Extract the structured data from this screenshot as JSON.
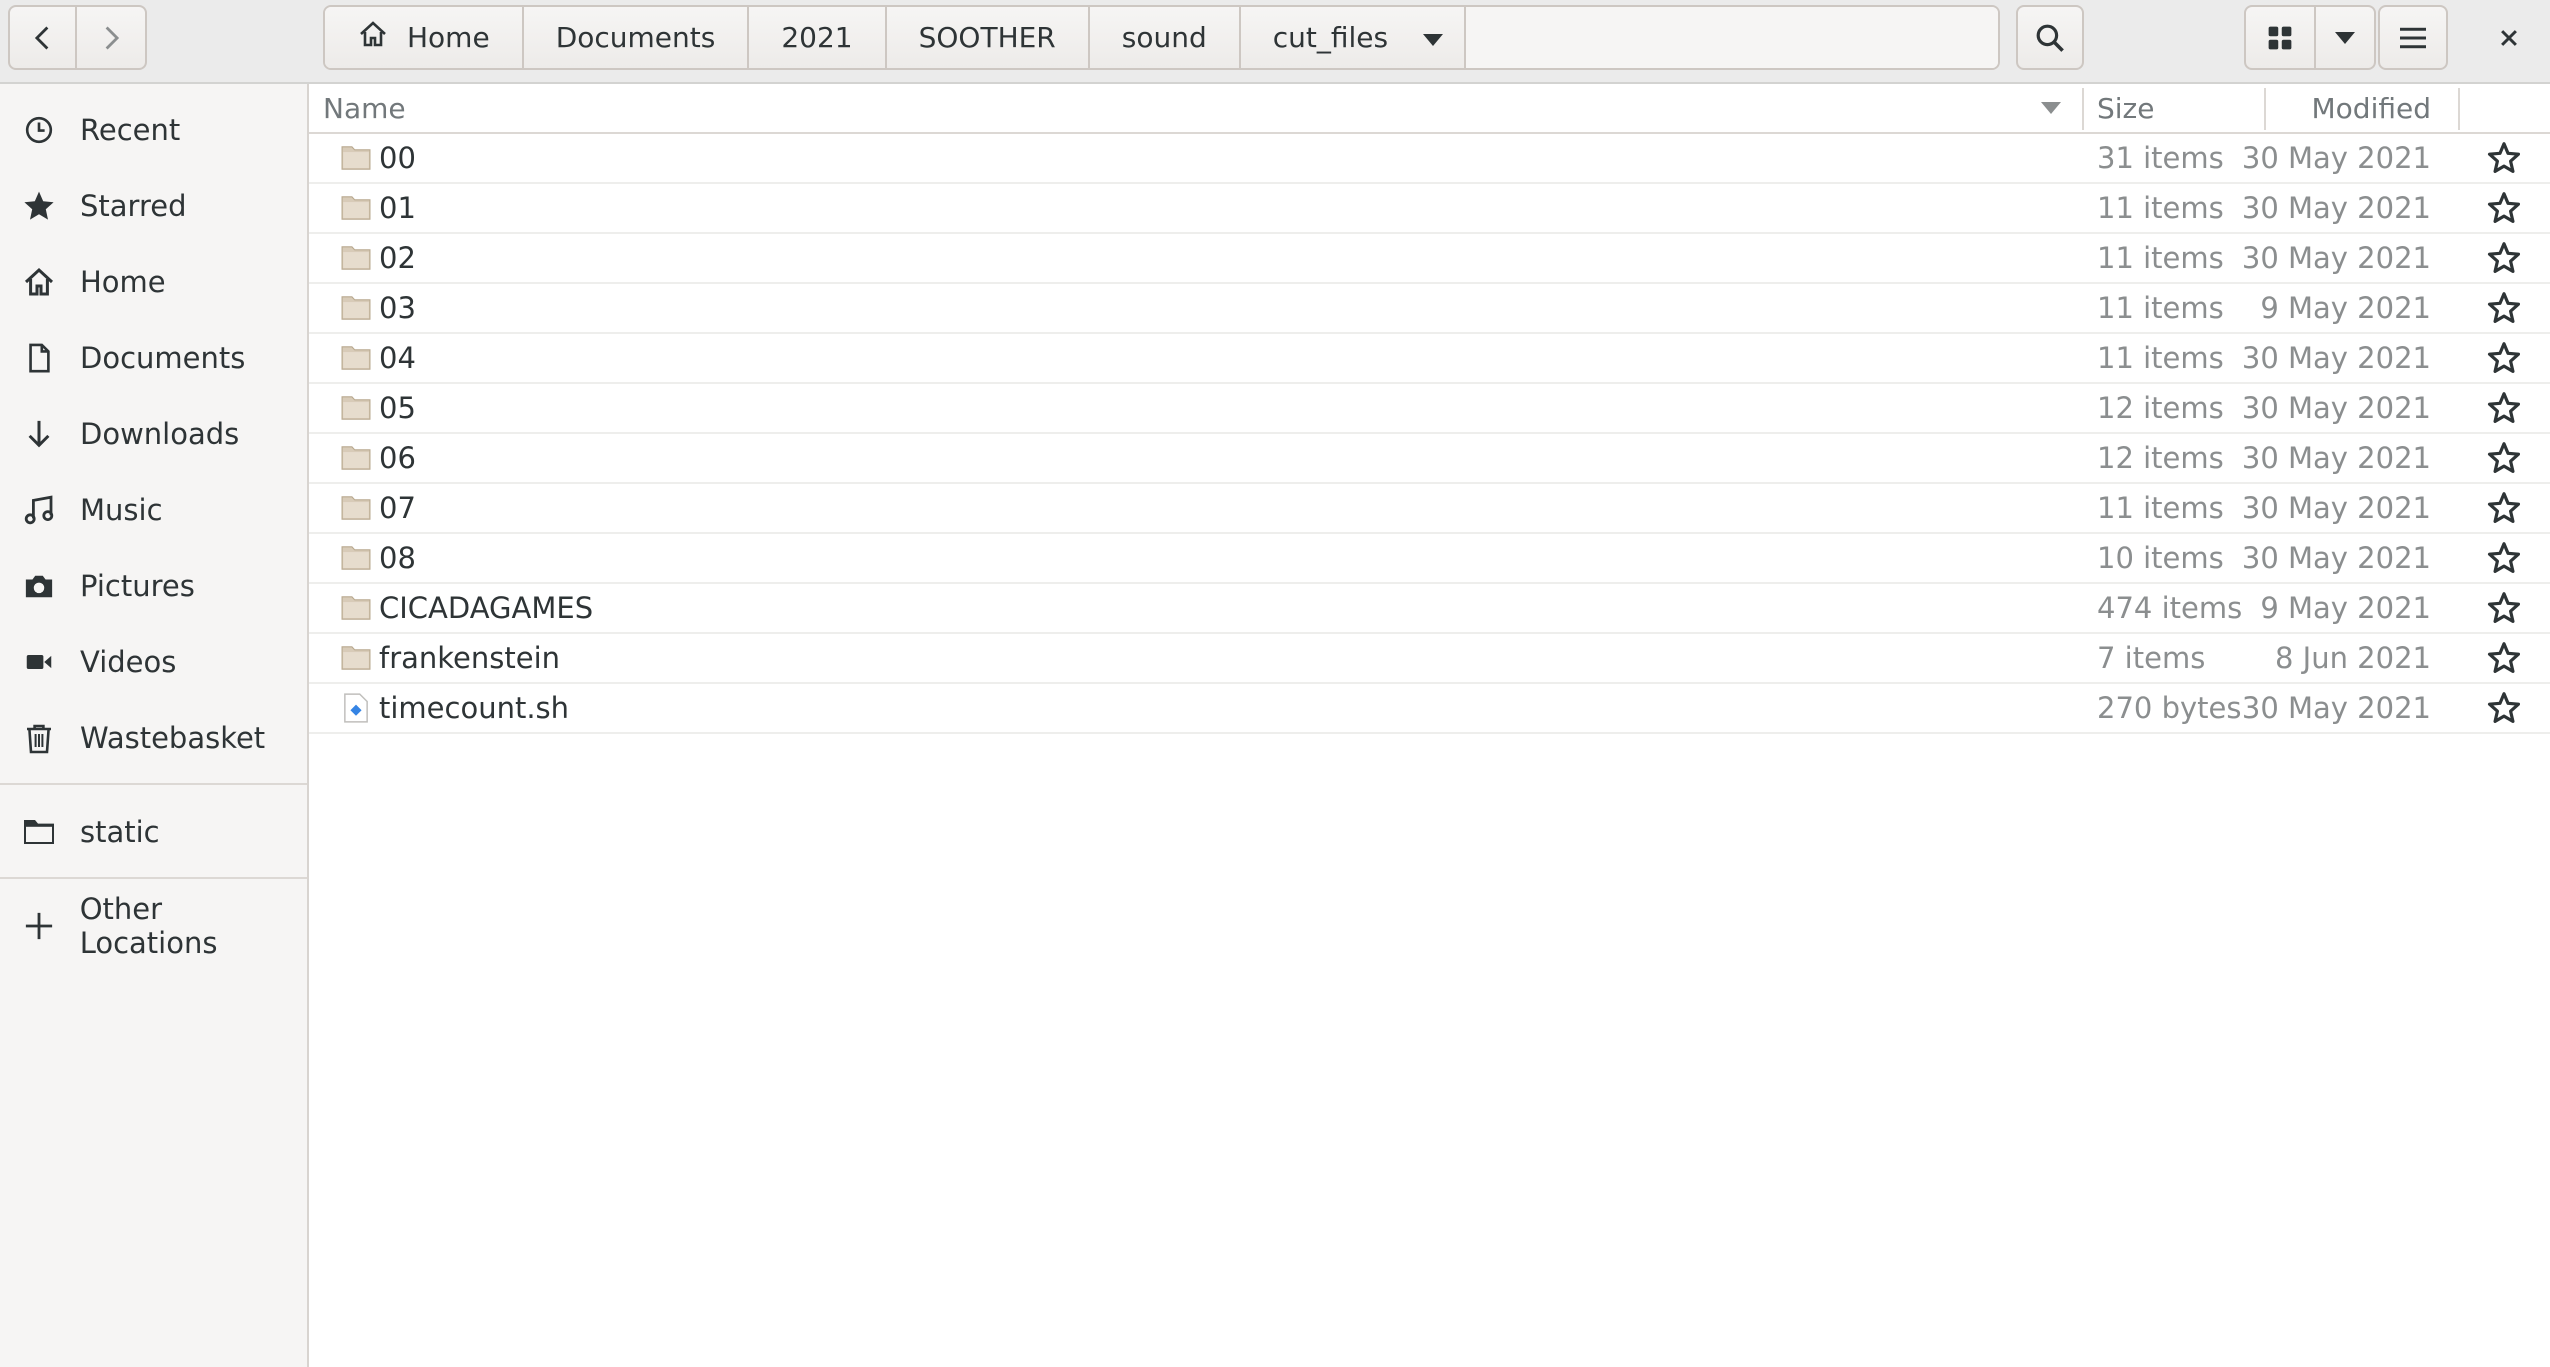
{
  "header": {
    "breadcrumbs": [
      "Home",
      "Documents",
      "2021",
      "SOOTHER",
      "sound",
      "cut_files"
    ],
    "icons": {
      "back": "go-previous-icon",
      "forward": "go-next-icon",
      "search": "search-icon",
      "view": "grid-view-icon",
      "view_options": "chevron-down-icon",
      "menu": "hamburger-menu-icon",
      "close": "close-icon"
    }
  },
  "sidebar": {
    "places": [
      {
        "label": "Recent",
        "icon": "clock-icon"
      },
      {
        "label": "Starred",
        "icon": "star-icon"
      },
      {
        "label": "Home",
        "icon": "home-icon"
      },
      {
        "label": "Documents",
        "icon": "document-icon"
      },
      {
        "label": "Downloads",
        "icon": "download-icon"
      },
      {
        "label": "Music",
        "icon": "music-icon"
      },
      {
        "label": "Pictures",
        "icon": "camera-icon"
      },
      {
        "label": "Videos",
        "icon": "video-icon"
      },
      {
        "label": "Wastebasket",
        "icon": "trash-icon"
      }
    ],
    "bookmarks": [
      {
        "label": "static",
        "icon": "folder-icon"
      }
    ],
    "other_locations": {
      "label": "Other Locations",
      "icon": "plus-icon"
    }
  },
  "list": {
    "columns": {
      "name": "Name",
      "size": "Size",
      "modified": "Modified"
    },
    "rows": [
      {
        "name": "00",
        "size": "31 items",
        "modified": "30 May 2021",
        "type": "folder"
      },
      {
        "name": "01",
        "size": "11 items",
        "modified": "30 May 2021",
        "type": "folder"
      },
      {
        "name": "02",
        "size": "11 items",
        "modified": "30 May 2021",
        "type": "folder"
      },
      {
        "name": "03",
        "size": "11 items",
        "modified": "9 May 2021",
        "type": "folder"
      },
      {
        "name": "04",
        "size": "11 items",
        "modified": "30 May 2021",
        "type": "folder"
      },
      {
        "name": "05",
        "size": "12 items",
        "modified": "30 May 2021",
        "type": "folder"
      },
      {
        "name": "06",
        "size": "12 items",
        "modified": "30 May 2021",
        "type": "folder"
      },
      {
        "name": "07",
        "size": "11 items",
        "modified": "30 May 2021",
        "type": "folder"
      },
      {
        "name": "08",
        "size": "10 items",
        "modified": "30 May 2021",
        "type": "folder"
      },
      {
        "name": "CICADAGAMES",
        "size": "474 items",
        "modified": "9 May 2021",
        "type": "folder"
      },
      {
        "name": "frankenstein",
        "size": "7 items",
        "modified": "8 Jun 2021",
        "type": "folder"
      },
      {
        "name": "timecount.sh",
        "size": "270 bytes",
        "modified": "30 May 2021",
        "type": "script"
      }
    ]
  },
  "colors": {
    "header_bg": "#ebebeb",
    "sidebar_bg": "#f6f5f4",
    "text": "#2e3436",
    "muted_text": "#8b8e8f",
    "folder": "#d8cbb8",
    "script_accent": "#3584e4"
  }
}
